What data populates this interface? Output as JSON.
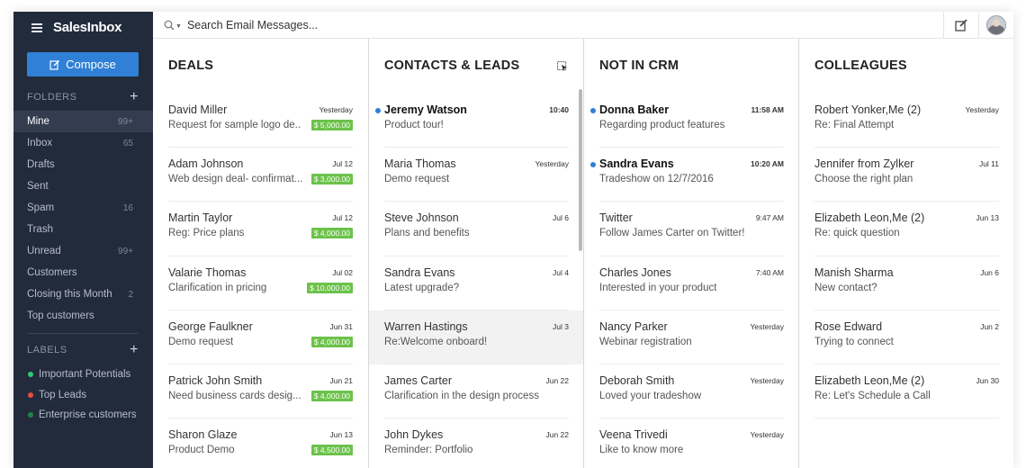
{
  "brand": {
    "name": "SalesInbox"
  },
  "compose": {
    "label": "Compose"
  },
  "search": {
    "placeholder": "Search Email Messages..."
  },
  "sidebar": {
    "folders_title": "FOLDERS",
    "labels_title": "LABELS",
    "folders": [
      {
        "label": "Mine",
        "count": "99+"
      },
      {
        "label": "Inbox",
        "count": "65"
      },
      {
        "label": "Drafts",
        "count": ""
      },
      {
        "label": "Sent",
        "count": ""
      },
      {
        "label": "Spam",
        "count": "16"
      },
      {
        "label": "Trash",
        "count": ""
      },
      {
        "label": "Unread",
        "count": "99+"
      },
      {
        "label": "Customers",
        "count": ""
      },
      {
        "label": "Closing this Month",
        "count": "2"
      },
      {
        "label": "Top customers",
        "count": ""
      }
    ],
    "labels": [
      {
        "label": "Important Potentials",
        "color": "#2ecc71"
      },
      {
        "label": "Top Leads",
        "color": "#e74c3c"
      },
      {
        "label": "Enterprise customers",
        "color": "#1e8449"
      }
    ]
  },
  "columns": [
    {
      "title": "DEALS",
      "rows": [
        {
          "name": "David Miller",
          "date": "Yesterday",
          "subject": "Request for sample logo de..",
          "amount": "$ 5,000.00"
        },
        {
          "name": "Adam Johnson",
          "date": "Jul 12",
          "subject": "Web design deal- confirmat...",
          "amount": "$ 3,000.00"
        },
        {
          "name": "Martin Taylor",
          "date": "Jul 12",
          "subject": "Reg: Price plans",
          "amount": "$ 4,000.00"
        },
        {
          "name": "Valarie Thomas",
          "date": "Jul 02",
          "subject": "Clarification in pricing",
          "amount": "$ 10,000.00"
        },
        {
          "name": "George Faulkner",
          "date": "Jun 31",
          "subject": "Demo request",
          "amount": "$ 4,000.00"
        },
        {
          "name": "Patrick John Smith",
          "date": "Jun 21",
          "subject": "Need business cards desig...",
          "amount": "$ 4,000.00"
        },
        {
          "name": "Sharon Glaze",
          "date": "Jun 13",
          "subject": "Product Demo",
          "amount": "$ 4,500.00"
        }
      ]
    },
    {
      "title": "CONTACTS & LEADS",
      "rows": [
        {
          "name": "Jeremy Watson",
          "date": "10:40",
          "subject": "Product tour!",
          "unread": true
        },
        {
          "name": "Maria Thomas",
          "date": "Yesterday",
          "subject": "Demo request"
        },
        {
          "name": "Steve Johnson",
          "date": "Jul 6",
          "subject": "Plans and benefits"
        },
        {
          "name": "Sandra Evans",
          "date": "Jul 4",
          "subject": "Latest upgrade?"
        },
        {
          "name": "Warren Hastings",
          "date": "Jul 3",
          "subject": "Re:Welcome onboard!",
          "highlight": true
        },
        {
          "name": "James Carter",
          "date": "Jun 22",
          "subject": "Clarification in the design process"
        },
        {
          "name": "John Dykes",
          "date": "Jun 22",
          "subject": "Reminder: Portfolio"
        }
      ]
    },
    {
      "title": "NOT IN CRM",
      "rows": [
        {
          "name": "Donna Baker",
          "date": "11:58 AM",
          "subject": "Regarding product features",
          "unread": true
        },
        {
          "name": "Sandra Evans",
          "date": "10:20 AM",
          "subject": "Tradeshow on 12/7/2016",
          "unread": true
        },
        {
          "name": "Twitter",
          "date": "9:47 AM",
          "subject": "Follow James Carter on Twitter!"
        },
        {
          "name": "Charles Jones",
          "date": "7:40 AM",
          "subject": "Interested in your product"
        },
        {
          "name": "Nancy Parker",
          "date": "Yesterday",
          "subject": "Webinar registration"
        },
        {
          "name": "Deborah Smith",
          "date": "Yesterday",
          "subject": "Loved your tradeshow"
        },
        {
          "name": "Veena Trivedi",
          "date": "Yesterday",
          "subject": "Like to know more"
        }
      ]
    },
    {
      "title": "COLLEAGUES",
      "rows": [
        {
          "name": "Robert Yonker,Me (2)",
          "date": "Yesterday",
          "subject": "Re: Final Attempt"
        },
        {
          "name": "Jennifer from Zylker",
          "date": "Jul 11",
          "subject": "Choose the right plan"
        },
        {
          "name": "Elizabeth Leon,Me (2)",
          "date": "Jun 13",
          "subject": "Re: quick question"
        },
        {
          "name": "Manish Sharma",
          "date": "Jun 6",
          "subject": "New contact?"
        },
        {
          "name": "Rose Edward",
          "date": "Jun 2",
          "subject": "Trying to connect"
        },
        {
          "name": "Elizabeth Leon,Me (2)",
          "date": "Jun 30",
          "subject": "Re: Let's Schedule a Call"
        }
      ]
    }
  ],
  "icons": {
    "search": "search-icon",
    "compose": "compose-edit-icon",
    "new_note": "new-note-icon",
    "select": "select-cursor-icon",
    "menu": "hamburger-menu-icon"
  }
}
